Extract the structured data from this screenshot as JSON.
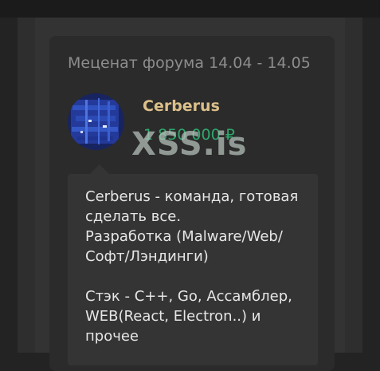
{
  "card": {
    "title": "Меценат форума 14.04 - 14.05"
  },
  "sponsor": {
    "name": "Cerberus",
    "amount": "1 850 000 ₽",
    "description": "Cerberus - команда, готовая сделать все.\nРазработка (Malware/Web/\nСофт/Лэндинги)\n\nСтэк - C++, Go, Ассамблер, WEB(React, Electron..) и\nпрочее"
  },
  "watermark": "XSS.is",
  "colors": {
    "name": "#dcc08a",
    "amount": "#2fa86c",
    "title": "#8d8d8d"
  }
}
